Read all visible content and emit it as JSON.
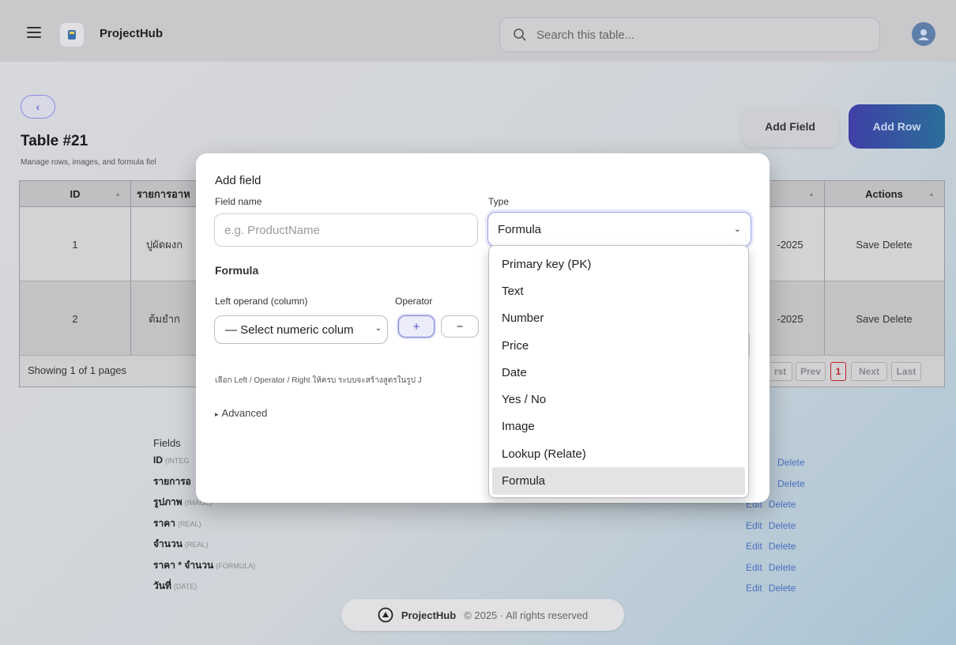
{
  "header": {
    "brand": "ProjectHub",
    "search_placeholder": "Search this table..."
  },
  "page": {
    "title": "Table #21",
    "subtitle": "Manage rows, images, and formula fiel",
    "add_field_label": "Add Field",
    "add_row_label": "Add Row"
  },
  "table": {
    "columns": [
      "ID",
      "รายการอาห",
      "",
      "Actions"
    ],
    "rows": [
      {
        "id": "1",
        "name": "ปูผัดผงก",
        "date": "-2025",
        "save": "Save",
        "delete": "Delete"
      },
      {
        "id": "2",
        "name": "ต้มยำก",
        "date": "-2025",
        "save": "Save",
        "delete": "Delete"
      }
    ],
    "footer_text": "Showing 1 of 1 pages",
    "pager": {
      "first": "rst",
      "prev": "Prev",
      "current": "1",
      "next": "Next",
      "last": "Last"
    }
  },
  "fields": {
    "title": "Fields",
    "items": [
      {
        "name": "ID",
        "type": "(INTEG",
        "edit": "",
        "delete": ""
      },
      {
        "name": "รายการอ",
        "type": "",
        "edit": "",
        "delete": "Delete"
      },
      {
        "name": "รูปภาพ",
        "type": "(IMAGE)",
        "edit": "Edit",
        "delete": "Delete"
      },
      {
        "name": "ราคา",
        "type": "(REAL)",
        "edit": "Edit",
        "delete": "Delete"
      },
      {
        "name": "จำนวน",
        "type": "(REAL)",
        "edit": "Edit",
        "delete": "Delete"
      },
      {
        "name": "ราคา * จำนวน",
        "type": "(FORMULA)",
        "edit": "Edit",
        "delete": "Delete"
      },
      {
        "name": "วันที่",
        "type": "(DATE)",
        "edit": "Edit",
        "delete": "Delete"
      }
    ]
  },
  "footer": {
    "brand": "ProjectHub",
    "copyright": "© 2025 · All rights reserved"
  },
  "modal": {
    "title": "Add field",
    "field_name_label": "Field name",
    "field_name_placeholder": "e.g. ProductName",
    "type_label": "Type",
    "type_value": "Formula",
    "section_title": "Formula",
    "left_operand_label": "Left operand (column)",
    "operator_label": "Operator",
    "left_select_value": "— Select numeric colum",
    "op_plus": "+",
    "op_minus": "−",
    "hint": "เลือก Left / Operator / Right ให้ครบ ระบบจะสร้างสูตรในรูป J",
    "advanced_label": "Advanced"
  },
  "type_dropdown": {
    "options": [
      "Primary key (PK)",
      "Text",
      "Number",
      "Price",
      "Date",
      "Yes / No",
      "Image",
      "Lookup (Relate)",
      "Formula"
    ],
    "selected": "Formula"
  },
  "colors": {
    "accent": "#4a4acb",
    "add_row_gradient_start": "#3f3fa6",
    "add_row_gradient_end": "#2b6e9a",
    "link": "#4a6fc0"
  },
  "icons": {
    "menu": "hamburger-icon",
    "logo": "logo-icon",
    "search": "search-icon",
    "avatar": "avatar-icon",
    "back": "chevron-left-icon",
    "select_chevron": "chevron-down-icon",
    "footer_logo": "brand-mark-icon"
  }
}
